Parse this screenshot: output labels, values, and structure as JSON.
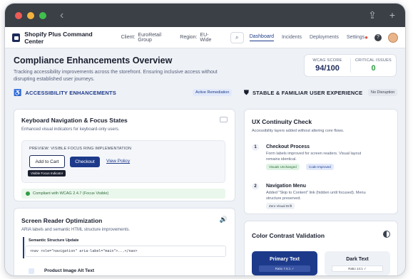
{
  "app": {
    "brand": "Shopify Plus Command Center",
    "client_label": "Client:",
    "client_value": "EuroRetail Group",
    "region_label": "Region:",
    "region_value": "EU-Wide",
    "nav": [
      "Dashboard",
      "Incidents",
      "Deployments",
      "Settings"
    ],
    "active_nav": "Dashboard",
    "icons": [
      "search-icon",
      "bell-icon",
      "help-icon",
      "avatar"
    ]
  },
  "page": {
    "title": "Compliance Enhancements Overview",
    "subtitle": "Tracking accessibility improvements across the storefront. Ensuring inclusive access without disrupting established user journeys."
  },
  "metrics": {
    "wcag_label": "WCAG SCORE",
    "wcag_value": "94/100",
    "issues_label": "CRITICAL ISSUES",
    "issues_value": "0"
  },
  "left": {
    "heading": "ACCESSIBILITY ENHANCEMENTS",
    "badge": "Active Remediation",
    "keyboard": {
      "title": "Keyboard Navigation & Focus States",
      "subtitle": "Enhanced visual indicators for keyboard-only users.",
      "preview_label": "PREVIEW: VISIBLE FOCUS RING IMPLEMENTATION",
      "btn_add": "Add to Cart",
      "btn_checkout": "Checkout",
      "link": "View Policy",
      "tooltip": "Visible Focus Indicator",
      "compliance": "Compliant with WCAG 2.4.7 (Focus Visible)"
    },
    "screenreader": {
      "title": "Screen Reader Optimization",
      "subtitle": "ARIA labels and semantic HTML structure improvements.",
      "update_label": "Semantic Structure Update",
      "code": "<nav role=\"navigation\" aria-label=\"main\">...</nav>",
      "next_item": "Product Image Alt Text"
    }
  },
  "right": {
    "heading": "STABLE & FAMILIAR USER EXPERIENCE",
    "badge": "No Disruption",
    "ux": {
      "title": "UX Continuity Check",
      "subtitle": "Accessibility layers added without altering core flows.",
      "steps": [
        {
          "num": "1",
          "title": "Checkout Process",
          "desc": "Form labels improved for screen readers. Visual layout remains identical.",
          "tags": [
            "Visuals Unchanged",
            "Code Improved"
          ]
        },
        {
          "num": "2",
          "title": "Navigation Menu",
          "desc": "Added \"Skip to Content\" link (hidden until focused). Menu structure preserved.",
          "tags": [
            "Zero Visual Drift"
          ]
        }
      ]
    },
    "contrast": {
      "title": "Color Contrast Validation",
      "primary_label": "Primary Text",
      "primary_ratio": "Ratio 7.5:1 ✓",
      "dark_label": "Dark Text",
      "dark_ratio": "Ratio 14:1 ✓"
    }
  },
  "colors": {
    "navy": "#1d2a5a",
    "accent_blue": "#1d3a8a",
    "success": "#2f9e44",
    "tag_green_bg": "#dff3e4",
    "tag_blue_bg": "#e1e9fb"
  }
}
